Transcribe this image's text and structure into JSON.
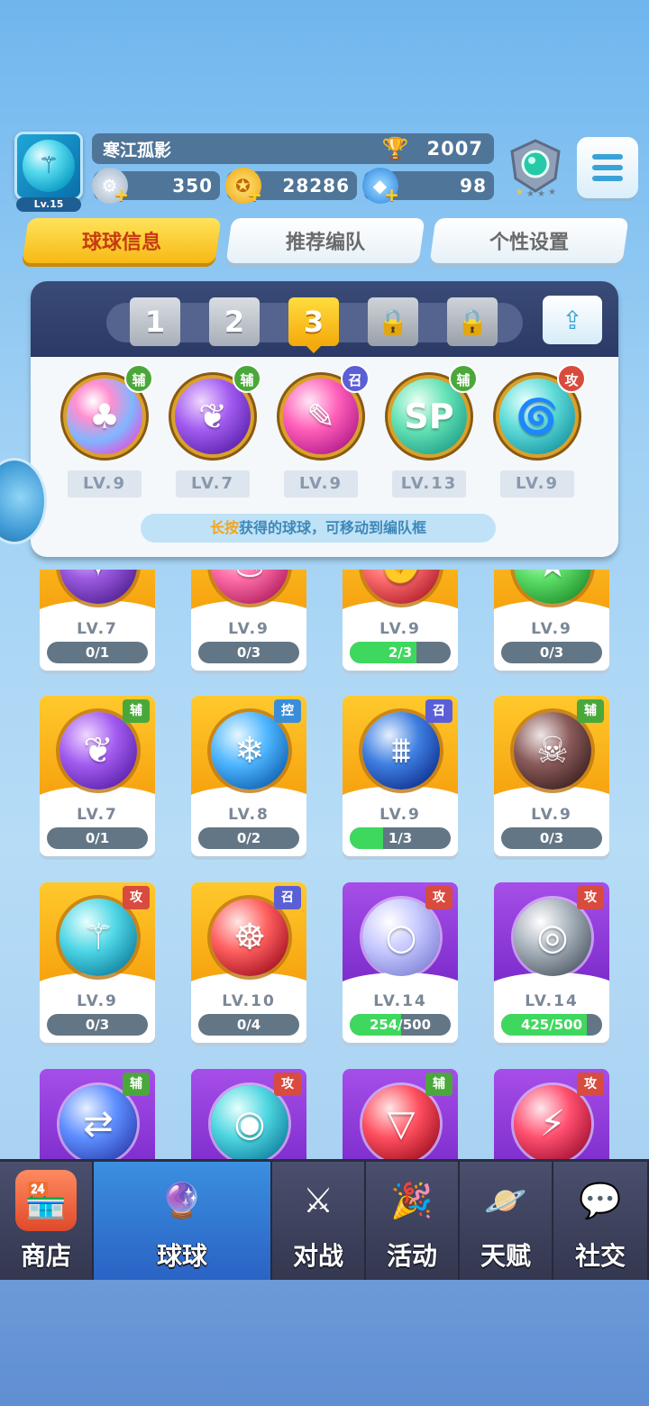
{
  "player": {
    "name": "寒江孤影",
    "level": "Lv.15",
    "trophy_score": "2007",
    "currency_silver": "350",
    "currency_gold": "28286",
    "currency_diamond": "98"
  },
  "tabs": [
    {
      "label": "球球信息",
      "active": true
    },
    {
      "label": "推荐编队",
      "active": false
    },
    {
      "label": "个性设置",
      "active": false
    }
  ],
  "team": {
    "slots": [
      {
        "label": "1",
        "state": "normal"
      },
      {
        "label": "2",
        "state": "normal"
      },
      {
        "label": "3",
        "state": "active"
      },
      {
        "label": "",
        "state": "locked"
      },
      {
        "label": "",
        "state": "locked"
      }
    ],
    "balls": [
      {
        "level": "LV.9",
        "tag": "辅",
        "icon": "rainbow-people-icon"
      },
      {
        "level": "LV.7",
        "tag": "辅",
        "icon": "leaf-icon"
      },
      {
        "level": "LV.9",
        "tag": "召",
        "icon": "feather-icon"
      },
      {
        "level": "LV.13",
        "tag": "辅",
        "icon": "sp-icon"
      },
      {
        "level": "LV.9",
        "tag": "攻",
        "icon": "tornado-icon"
      }
    ],
    "hint_highlight": "长按",
    "hint_rest": "获得的球球，可移动到编队框"
  },
  "cards": [
    {
      "level": "LV.7",
      "progress": "0/1",
      "fill": 0,
      "style": "gold",
      "tag": "",
      "icon": "star-web-icon"
    },
    {
      "level": "LV.9",
      "progress": "0/3",
      "fill": 0,
      "style": "gold",
      "tag": "",
      "icon": "drop-icon"
    },
    {
      "level": "LV.9",
      "progress": "2/3",
      "fill": 0.66,
      "style": "gold",
      "tag": "",
      "icon": "fist-icon"
    },
    {
      "level": "LV.9",
      "progress": "0/3",
      "fill": 0,
      "style": "gold",
      "tag": "",
      "icon": "green-star-icon"
    },
    {
      "level": "LV.7",
      "progress": "0/1",
      "fill": 0,
      "style": "gold",
      "tag": "辅",
      "icon": "leaf-icon"
    },
    {
      "level": "LV.8",
      "progress": "0/2",
      "fill": 0,
      "style": "gold",
      "tag": "控",
      "icon": "snowflake-icon"
    },
    {
      "level": "LV.9",
      "progress": "1/3",
      "fill": 0.33,
      "style": "gold",
      "tag": "召",
      "icon": "ice-icon"
    },
    {
      "level": "LV.9",
      "progress": "0/3",
      "fill": 0,
      "style": "gold",
      "tag": "辅",
      "icon": "skull-icon"
    },
    {
      "level": "LV.9",
      "progress": "0/3",
      "fill": 0,
      "style": "gold",
      "tag": "攻",
      "icon": "trident-icon"
    },
    {
      "level": "LV.10",
      "progress": "0/4",
      "fill": 0,
      "style": "gold",
      "tag": "召",
      "icon": "cannon-icon"
    },
    {
      "level": "LV.14",
      "progress": "254/500",
      "fill": 0.508,
      "style": "purple",
      "tag": "攻",
      "icon": "bubble-icon"
    },
    {
      "level": "LV.14",
      "progress": "425/500",
      "fill": 0.85,
      "style": "purple",
      "tag": "攻",
      "icon": "vortex-icon"
    },
    {
      "level": "",
      "progress": "",
      "fill": 0,
      "style": "purple",
      "tag": "辅",
      "icon": "swap-arrows-icon"
    },
    {
      "level": "",
      "progress": "",
      "fill": 0,
      "style": "purple",
      "tag": "攻",
      "icon": "swirl-icon"
    },
    {
      "level": "",
      "progress": "",
      "fill": 0,
      "style": "purple",
      "tag": "辅",
      "icon": "fang-icon"
    },
    {
      "level": "",
      "progress": "",
      "fill": 0,
      "style": "purple",
      "tag": "攻",
      "icon": "crack-icon"
    }
  ],
  "nav": [
    {
      "label": "商店",
      "icon": "shop-icon",
      "active": false
    },
    {
      "label": "球球",
      "icon": "ball-jar-icon",
      "active": true
    },
    {
      "label": "对战",
      "icon": "crossed-swords-icon",
      "active": false
    },
    {
      "label": "活动",
      "icon": "party-popper-icon",
      "active": false
    },
    {
      "label": "天赋",
      "icon": "planet-icon",
      "active": false
    },
    {
      "label": "社交",
      "icon": "chat-heart-icon",
      "active": false
    }
  ],
  "colors": {
    "tab_active": "#f7b915",
    "tab_active_text": "#c73a12",
    "panel_header": "#2a3965",
    "nav_active": "#2a63c4",
    "progress_fill": "#3ed85e",
    "tag_fu": "#4aa83b",
    "tag_gong": "#d84b3e",
    "tag_zhao": "#5a5fd6",
    "tag_kong": "#3a8ed8"
  }
}
